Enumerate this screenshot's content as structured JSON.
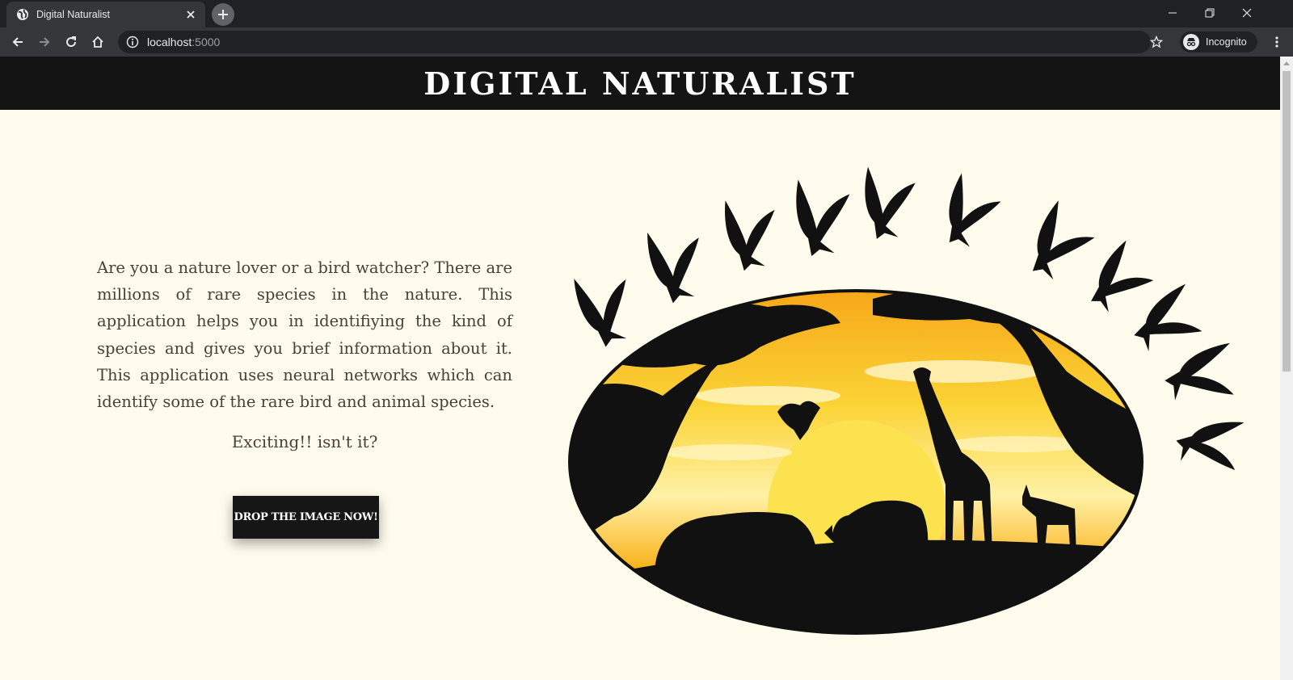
{
  "browser": {
    "tab_title": "Digital Naturalist",
    "url_host": "localhost",
    "url_port": ":5000",
    "profile_label": "Incognito"
  },
  "page": {
    "title": "DIGITAL NATURALIST",
    "intro": "Are you a nature lover or a bird watcher? There are millions of rare species in the nature. This application helps you in identifiying the kind of species and gives you brief information about it. This application uses neural networks which can identify some of the rare bird and animal species.",
    "exciting": "Exciting!! isn't it?",
    "cta_label": "DROP THE IMAGE NOW!"
  },
  "colors": {
    "page_bg": "#fffcee",
    "header_bg": "#141414",
    "text": "#4a3f35",
    "button_bg": "#161616",
    "sunset_yellow": "#f6c21f",
    "sunset_orange": "#f28b12"
  },
  "icons": [
    "globe-icon",
    "close-icon",
    "plus-icon",
    "minimize-icon",
    "restore-icon",
    "back-icon",
    "forward-icon",
    "reload-icon",
    "home-icon",
    "info-icon",
    "star-icon",
    "incognito-icon",
    "more-vert-icon"
  ]
}
